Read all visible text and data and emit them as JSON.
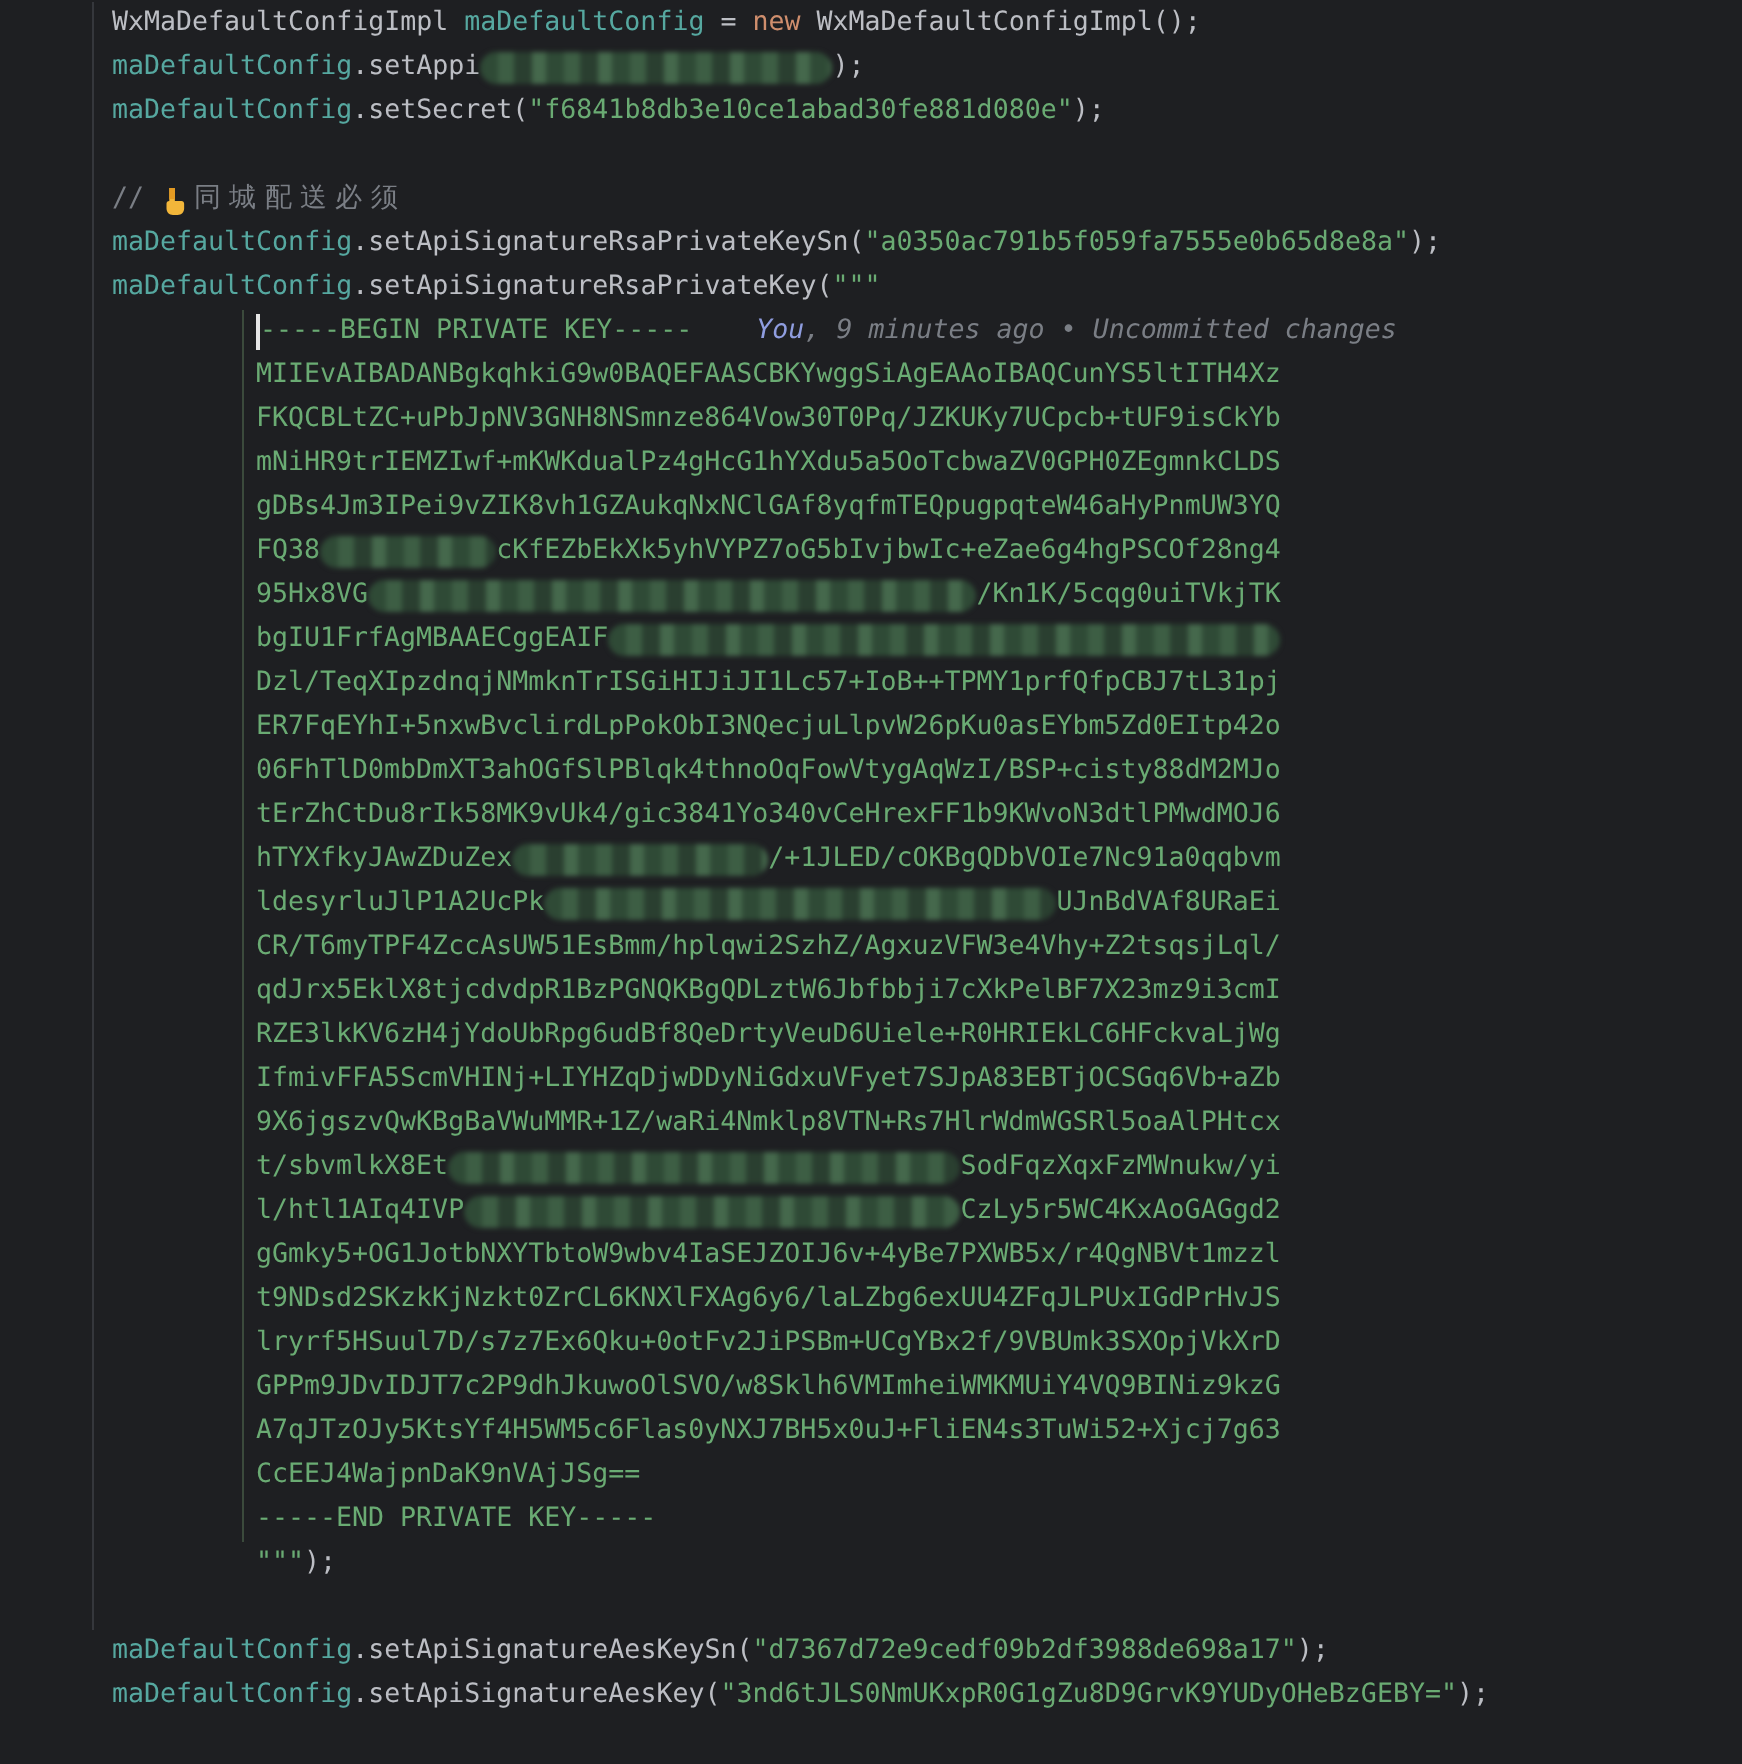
{
  "editor": {
    "lines": [
      {
        "kind": "code",
        "tokens": [
          {
            "kind": "type",
            "text": "WxMaDefaultConfigImpl"
          },
          {
            "kind": "field",
            "text": "maDefaultConfig"
          },
          {
            "kind": "plain",
            "text": "="
          },
          {
            "kind": "keyword",
            "text": "new"
          },
          {
            "kind": "type",
            "text": "WxMaDefaultConfigImpl();"
          }
        ]
      },
      {
        "kind": "code",
        "tokens": [
          {
            "kind": "field",
            "text": "maDefaultConfig"
          },
          {
            "kind": "plain",
            "text": ".setAppi"
          },
          {
            "kind": "redacted"
          },
          {
            "kind": "plain",
            "text": ");"
          }
        ]
      },
      {
        "kind": "code",
        "tokens": [
          {
            "kind": "field",
            "text": "maDefaultConfig"
          },
          {
            "kind": "plain",
            "text": ".setSecret("
          },
          {
            "kind": "string",
            "text": "\"f6841b8db3e10ce1abad30fe881d080e\""
          },
          {
            "kind": "plain",
            "text": ");"
          }
        ]
      },
      {
        "kind": "blank"
      },
      {
        "kind": "code",
        "tokens": [
          {
            "kind": "comment",
            "text": "//"
          },
          {
            "kind": "hand"
          },
          {
            "kind": "comment",
            "text": "同城配送必须"
          }
        ]
      },
      {
        "kind": "code",
        "tokens": [
          {
            "kind": "field",
            "text": "maDefaultConfig"
          },
          {
            "kind": "plain",
            "text": ".setApiSignatureRsaPrivateKeySn("
          },
          {
            "kind": "string",
            "text": "\"a0350ac791b5f059fa7555e0b65d8e8a\""
          },
          {
            "kind": "plain",
            "text": ");"
          }
        ]
      },
      {
        "kind": "code",
        "tokens": [
          {
            "kind": "field",
            "text": "maDefaultConfig"
          },
          {
            "kind": "plain",
            "text": ".setApiSignatureRsaPrivateKey("
          },
          {
            "kind": "string",
            "text": "\"\"\""
          }
        ]
      },
      {
        "kind": "literal",
        "cursor": true,
        "tokens": [
          {
            "kind": "string",
            "text": "-----BEGIN PRIVATE KEY-----"
          }
        ],
        "blame": [
          {
            "kind": "author",
            "text": "You"
          },
          {
            "kind": "punct",
            "text": ","
          },
          {
            "kind": "meta",
            "text": "9 minutes ago"
          },
          {
            "kind": "meta",
            "text": "•"
          },
          {
            "kind": "meta",
            "text": "Uncommitted changes"
          }
        ]
      },
      {
        "kind": "literal",
        "tokens": [
          {
            "kind": "string",
            "text": "MIIEvAIBADANBgkqhkiG9w0BAQEFAASCBKYwggSiAgEAAoIBAQCunYS5ltITH4Xz"
          }
        ]
      },
      {
        "kind": "literal",
        "tokens": [
          {
            "kind": "string",
            "text": "FKQCBLtZC+uPbJpNV3GNH8NSmnze864Vow30T0Pq/JZKUKy7UCpcb+tUF9isCkYb"
          }
        ]
      },
      {
        "kind": "literal",
        "tokens": [
          {
            "kind": "string",
            "text": "mNiHR9trIEMZIwf+mKWKdualPz4gHcG1hYXdu5a5OoTcbwaZV0GPH0ZEgmnkCLDS"
          }
        ]
      },
      {
        "kind": "literal",
        "tokens": [
          {
            "kind": "string",
            "text": "gDBs4Jm3IPei9vZIK8vh1GZAukqNxNClGAf8yqfmTEQpugpqteW46aHyPnmUW3YQ"
          }
        ]
      },
      {
        "kind": "literal",
        "tokens": [
          {
            "kind": "string",
            "text": "FQ38"
          },
          {
            "kind": "redacted"
          },
          {
            "kind": "string",
            "text": "cKfEZbEkXk5yhVYPZ7oG5bIvjbwIc+eZae6g4hgPSCOf28ng4"
          }
        ]
      },
      {
        "kind": "literal",
        "tokens": [
          {
            "kind": "string",
            "text": "95Hx8VG"
          },
          {
            "kind": "redacted"
          },
          {
            "kind": "string",
            "text": "/Kn1K/5cqg0uiTVkjTK"
          }
        ]
      },
      {
        "kind": "literal",
        "tokens": [
          {
            "kind": "string",
            "text": "bgIU1FrfAgMBAAECggEAIF"
          },
          {
            "kind": "redacted"
          }
        ]
      },
      {
        "kind": "literal",
        "tokens": [
          {
            "kind": "string",
            "text": "Dzl/TeqXIpzdnqjNMmknTrISGiHIJiJI1Lc57+IoB++TPMY1prfQfpCBJ7tL31pj"
          }
        ]
      },
      {
        "kind": "literal",
        "tokens": [
          {
            "kind": "string",
            "text": "ER7FqEYhI+5nxwBvclirdLpPokObI3NQecjuLlpvW26pKu0asEYbm5Zd0EItp42o"
          }
        ]
      },
      {
        "kind": "literal",
        "tokens": [
          {
            "kind": "string",
            "text": "06FhTlD0mbDmXT3ahOGfSlPBlqk4thnoOqFowVtygAqWzI/BSP+cisty88dM2MJo"
          }
        ]
      },
      {
        "kind": "literal",
        "tokens": [
          {
            "kind": "string",
            "text": "tErZhCtDu8rIk58MK9vUk4/gic3841Yo340vCeHrexFF1b9KWvoN3dtlPMwdMOJ6"
          }
        ]
      },
      {
        "kind": "literal",
        "tokens": [
          {
            "kind": "string",
            "text": "hTYXfkyJAwZDuZex"
          },
          {
            "kind": "redacted"
          },
          {
            "kind": "string",
            "text": "/+1JLED/cOKBgQDbVOIe7Nc91a0qqbvm"
          }
        ]
      },
      {
        "kind": "literal",
        "tokens": [
          {
            "kind": "string",
            "text": "ldesyrluJlP1A2UcPk"
          },
          {
            "kind": "redacted"
          },
          {
            "kind": "string",
            "text": "UJnBdVAf8URaEi"
          }
        ]
      },
      {
        "kind": "literal",
        "tokens": [
          {
            "kind": "string",
            "text": "CR/T6myTPF4ZccAsUW51EsBmm/hplqwi2SzhZ/AgxuzVFW3e4Vhy+Z2tsqsjLql/"
          }
        ]
      },
      {
        "kind": "literal",
        "tokens": [
          {
            "kind": "string",
            "text": "qdJrx5EklX8tjcdvdpR1BzPGNQKBgQDLztW6Jbfbbji7cXkPelBF7X23mz9i3cmI"
          }
        ]
      },
      {
        "kind": "literal",
        "tokens": [
          {
            "kind": "string",
            "text": "RZE3lkKV6zH4jYdoUbRpg6udBf8QeDrtyVeuD6Uiele+R0HRIEkLC6HFckvaLjWg"
          }
        ]
      },
      {
        "kind": "literal",
        "tokens": [
          {
            "kind": "string",
            "text": "IfmivFFA5ScmVHINj+LIYHZqDjwDDyNiGdxuVFyet7SJpA83EBTjOCSGq6Vb+aZb"
          }
        ]
      },
      {
        "kind": "literal",
        "tokens": [
          {
            "kind": "string",
            "text": "9X6jgszvQwKBgBaVWuMMR+1Z/waRi4Nmklp8VTN+Rs7HlrWdmWGSRl5oaAlPHtcx"
          }
        ]
      },
      {
        "kind": "literal",
        "tokens": [
          {
            "kind": "string",
            "text": "t/sbvmlkX8Et"
          },
          {
            "kind": "redacted"
          },
          {
            "kind": "string",
            "text": "SodFqzXqxFzMWnukw/yi"
          }
        ]
      },
      {
        "kind": "literal",
        "tokens": [
          {
            "kind": "string",
            "text": "l/htl1AIq4IVP"
          },
          {
            "kind": "redacted"
          },
          {
            "kind": "string",
            "text": "CzLy5r5WC4KxAoGAGgd2"
          }
        ]
      },
      {
        "kind": "literal",
        "tokens": [
          {
            "kind": "string",
            "text": "gGmky5+OG1JotbNXYTbtoW9wbv4IaSEJZOIJ6v+4yBe7PXWB5x/r4QgNBVt1mzzl"
          }
        ]
      },
      {
        "kind": "literal",
        "tokens": [
          {
            "kind": "string",
            "text": "t9NDsd2SKzkKjNzkt0ZrCL6KNXlFXAg6y6/laLZbg6exUU4ZFqJLPUxIGdPrHvJS"
          }
        ]
      },
      {
        "kind": "literal",
        "tokens": [
          {
            "kind": "string",
            "text": "lryrf5HSuul7D/s7z7Ex6Qku+0otFv2JiPSBm+UCgYBx2f/9VBUmk3SXOpjVkXrD"
          }
        ]
      },
      {
        "kind": "literal",
        "tokens": [
          {
            "kind": "string",
            "text": "GPPm9JDvIDJT7c2P9dhJkuwoOlSVO/w8Sklh6VMImheiWMKMUiY4VQ9BINiz9kzG"
          }
        ]
      },
      {
        "kind": "literal",
        "tokens": [
          {
            "kind": "string",
            "text": "A7qJTzOJy5KtsYf4H5WM5c6Flas0yNXJ7BH5x0uJ+FliEN4s3TuWi52+Xjcj7g63"
          }
        ]
      },
      {
        "kind": "literal",
        "tokens": [
          {
            "kind": "string",
            "text": "CcEEJ4WajpnDaK9nVAjJSg=="
          }
        ]
      },
      {
        "kind": "literal",
        "tokens": [
          {
            "kind": "string",
            "text": "-----END PRIVATE KEY-----"
          }
        ]
      },
      {
        "kind": "inner",
        "tokens": [
          {
            "kind": "string",
            "text": "\"\"\""
          },
          {
            "kind": "plain",
            "text": ");"
          }
        ]
      },
      {
        "kind": "blank"
      },
      {
        "kind": "code",
        "tokens": [
          {
            "kind": "field",
            "text": "maDefaultConfig"
          },
          {
            "kind": "plain",
            "text": ".setApiSignatureAesKeySn("
          },
          {
            "kind": "string",
            "text": "\"d7367d72e9cedf09b2df3988de698a17\""
          },
          {
            "kind": "plain",
            "text": ");"
          }
        ]
      },
      {
        "kind": "code",
        "tokens": [
          {
            "kind": "field",
            "text": "maDefaultConfig"
          },
          {
            "kind": "plain",
            "text": ".setApiSignatureAesKey("
          },
          {
            "kind": "string",
            "text": "\"3nd6tJLS0NmUKxpR0G1gZu8D9GrvK9YUDyOHeBzGEBY=\""
          },
          {
            "kind": "plain",
            "text": ");"
          }
        ]
      }
    ]
  }
}
